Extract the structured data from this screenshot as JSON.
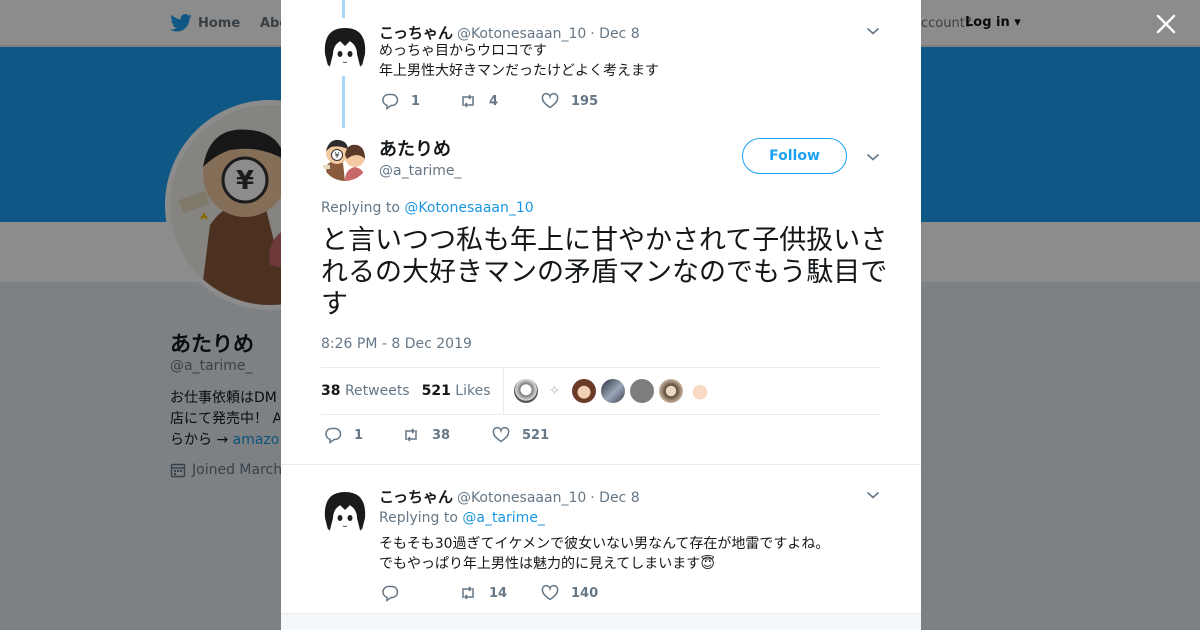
{
  "nav": {
    "home_label": "Home",
    "about_label": "Abo",
    "account_prompt": "ccount?",
    "login_label": "Log in"
  },
  "profile": {
    "name": "あたりめ",
    "handle": "@a_tarime_",
    "bio_line1": "お仕事依頼はDM",
    "bio_line2": "店にて発売中！ A",
    "bio_line3_prefix": "らから → ",
    "bio_link": "amazon",
    "joined": "Joined March"
  },
  "tweets": [
    {
      "author": "こっちゃん",
      "handle": "@Kotonesaaan_10",
      "date": "· Dec 8",
      "line1": "めっちゃ目からウロコです",
      "line2": "年上男性大好きマンだったけどよく考えます",
      "replies": "1",
      "retweets": "4",
      "likes": "195"
    }
  ],
  "focus": {
    "author": "あたりめ",
    "handle": "@a_tarime_",
    "follow_label": "Follow",
    "replying_prefix": "Replying to",
    "replying_to": "@Kotonesaaan_10",
    "text": "と言いつつ私も年上に甘やかされて子供扱いされるの大好きマンの矛盾マンなのでもう駄目です",
    "timestamp": "8:26 PM - 8 Dec 2019",
    "retweet_count": "38",
    "retweet_label": "Retweets",
    "like_count": "521",
    "like_label": "Likes",
    "replies": "1",
    "retweets": "38",
    "likes": "521"
  },
  "reply": {
    "author": "こっちゃん",
    "handle": "@Kotonesaaan_10",
    "date": "· Dec 8",
    "replying_prefix": "Replying to",
    "replying_to": "@a_tarime_",
    "line1": "そもそも30過ぎてイケメンで彼女いない男なんて存在が地雷ですよね。",
    "line2": "でもやっぱり年上男性は魅力的に見えてしまいます",
    "emoji": "😇",
    "replies": "",
    "retweets": "14",
    "likes": "140"
  },
  "colors": {
    "accent": "#1da1f2",
    "thread": "#a8d7f7",
    "text": "#14171a",
    "muted": "#657786"
  },
  "icons": [
    "twitter-bird-icon",
    "close-icon",
    "chevron-down-icon",
    "reply-icon",
    "retweet-icon",
    "like-icon",
    "calendar-icon"
  ]
}
